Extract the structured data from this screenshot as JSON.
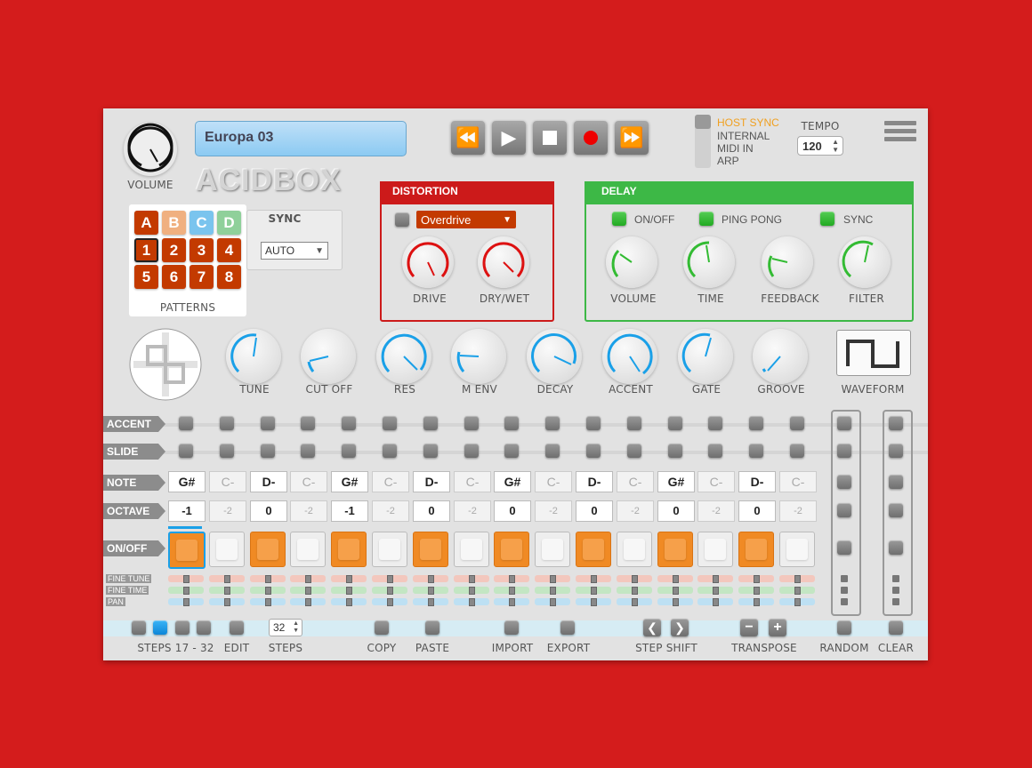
{
  "app": {
    "logo_text": "ACIDBOX",
    "preset_name": "Europa 03"
  },
  "volume": {
    "label": "VOLUME"
  },
  "transport": {
    "buttons": [
      "rewind-icon",
      "play-icon",
      "stop-icon",
      "record-icon",
      "fast-forward-icon"
    ]
  },
  "sync_mode": {
    "options": [
      "HOST SYNC",
      "INTERNAL",
      "MIDI IN",
      "ARP"
    ],
    "active": "HOST SYNC",
    "active_color": "#f0a020"
  },
  "tempo": {
    "label": "TEMPO",
    "value": "120"
  },
  "patterns": {
    "banks": [
      "A",
      "B",
      "C",
      "D"
    ],
    "bank_colors": [
      "#c33a00",
      "#f0b080",
      "#7ac4ee",
      "#8fd09a"
    ],
    "numbers": [
      "1",
      "2",
      "3",
      "4",
      "5",
      "6",
      "7",
      "8"
    ],
    "selected": "1",
    "label": "PATTERNS"
  },
  "sync": {
    "label": "SYNC",
    "value": "AUTO"
  },
  "distortion": {
    "title": "DISTORTION",
    "type": "Overdrive",
    "knobs": [
      "DRIVE",
      "DRY/WET"
    ],
    "color": "#cc1a1a"
  },
  "delay": {
    "title": "DELAY",
    "toggles": [
      "ON/OFF",
      "PING PONG",
      "SYNC"
    ],
    "knobs": [
      "VOLUME",
      "TIME",
      "FEEDBACK",
      "FILTER"
    ],
    "color": "#3db846"
  },
  "synth_knobs": [
    "TUNE",
    "CUT OFF",
    "RES",
    "M ENV",
    "DECAY",
    "ACCENT",
    "GATE",
    "GROOVE"
  ],
  "waveform": {
    "label": "WAVEFORM",
    "shape": "square-wave-icon"
  },
  "rows": {
    "accent": "ACCENT",
    "slide": "SLIDE",
    "note": "NOTE",
    "octave": "OCTAVE",
    "onoff": "ON/OFF",
    "fine_tune": "FINE TUNE",
    "fine_time": "FINE TIME",
    "pan": "PAN"
  },
  "steps": {
    "notes": [
      "G#",
      "C-",
      "D-",
      "C-",
      "G#",
      "C-",
      "D-",
      "C-",
      "G#",
      "C-",
      "D-",
      "C-",
      "G#",
      "C-",
      "D-",
      "C-"
    ],
    "notes_dim": [
      false,
      true,
      false,
      true,
      false,
      true,
      false,
      true,
      false,
      true,
      false,
      true,
      false,
      true,
      false,
      true
    ],
    "octaves": [
      "-1",
      "-2",
      "0",
      "-2",
      "-1",
      "-2",
      "0",
      "-2",
      "0",
      "-2",
      "0",
      "-2",
      "0",
      "-2",
      "0",
      "-2"
    ],
    "on": [
      true,
      false,
      true,
      false,
      true,
      false,
      true,
      false,
      true,
      false,
      true,
      false,
      true,
      false,
      true,
      false
    ]
  },
  "bottom": {
    "steps_range": "STEPS 17 - 32",
    "edit": "EDIT",
    "steps_label": "STEPS",
    "steps_value": "32",
    "copy": "COPY",
    "paste": "PASTE",
    "import": "IMPORT",
    "export": "EXPORT",
    "step_shift": "STEP SHIFT",
    "transpose": "TRANSPOSE",
    "random": "RANDOM",
    "clear": "CLEAR"
  }
}
